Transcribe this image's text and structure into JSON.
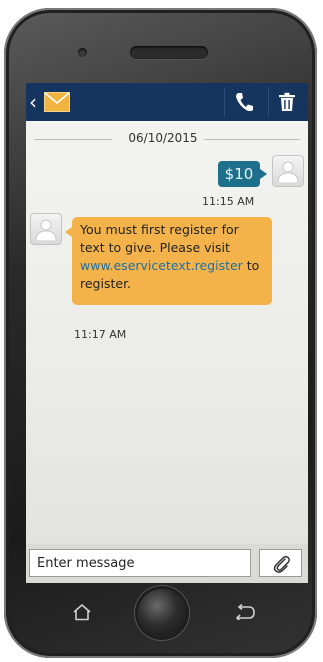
{
  "conversation": {
    "date": "06/10/2015",
    "sent_message": {
      "text": "$10",
      "time": "11:15 AM"
    },
    "received_message": {
      "text_before_link": "You must first register for text to give. Please visit ",
      "link": "www.eservicetext.register",
      "text_after_link": " to register.",
      "time": "11:17 AM"
    }
  },
  "composer": {
    "placeholder": "Enter message"
  },
  "colors": {
    "app_bar": "#15355e",
    "sent_bubble": "#1d6f8c",
    "received_bubble": "#f3b34a",
    "mail_icon": "#f2b440"
  },
  "icons": {
    "back": "chevron-left-icon",
    "app": "envelope-icon",
    "call": "phone-icon",
    "delete": "trash-icon",
    "attach": "paperclip-icon",
    "nav_home": "home-icon",
    "nav_back": "back-arrow-icon"
  }
}
